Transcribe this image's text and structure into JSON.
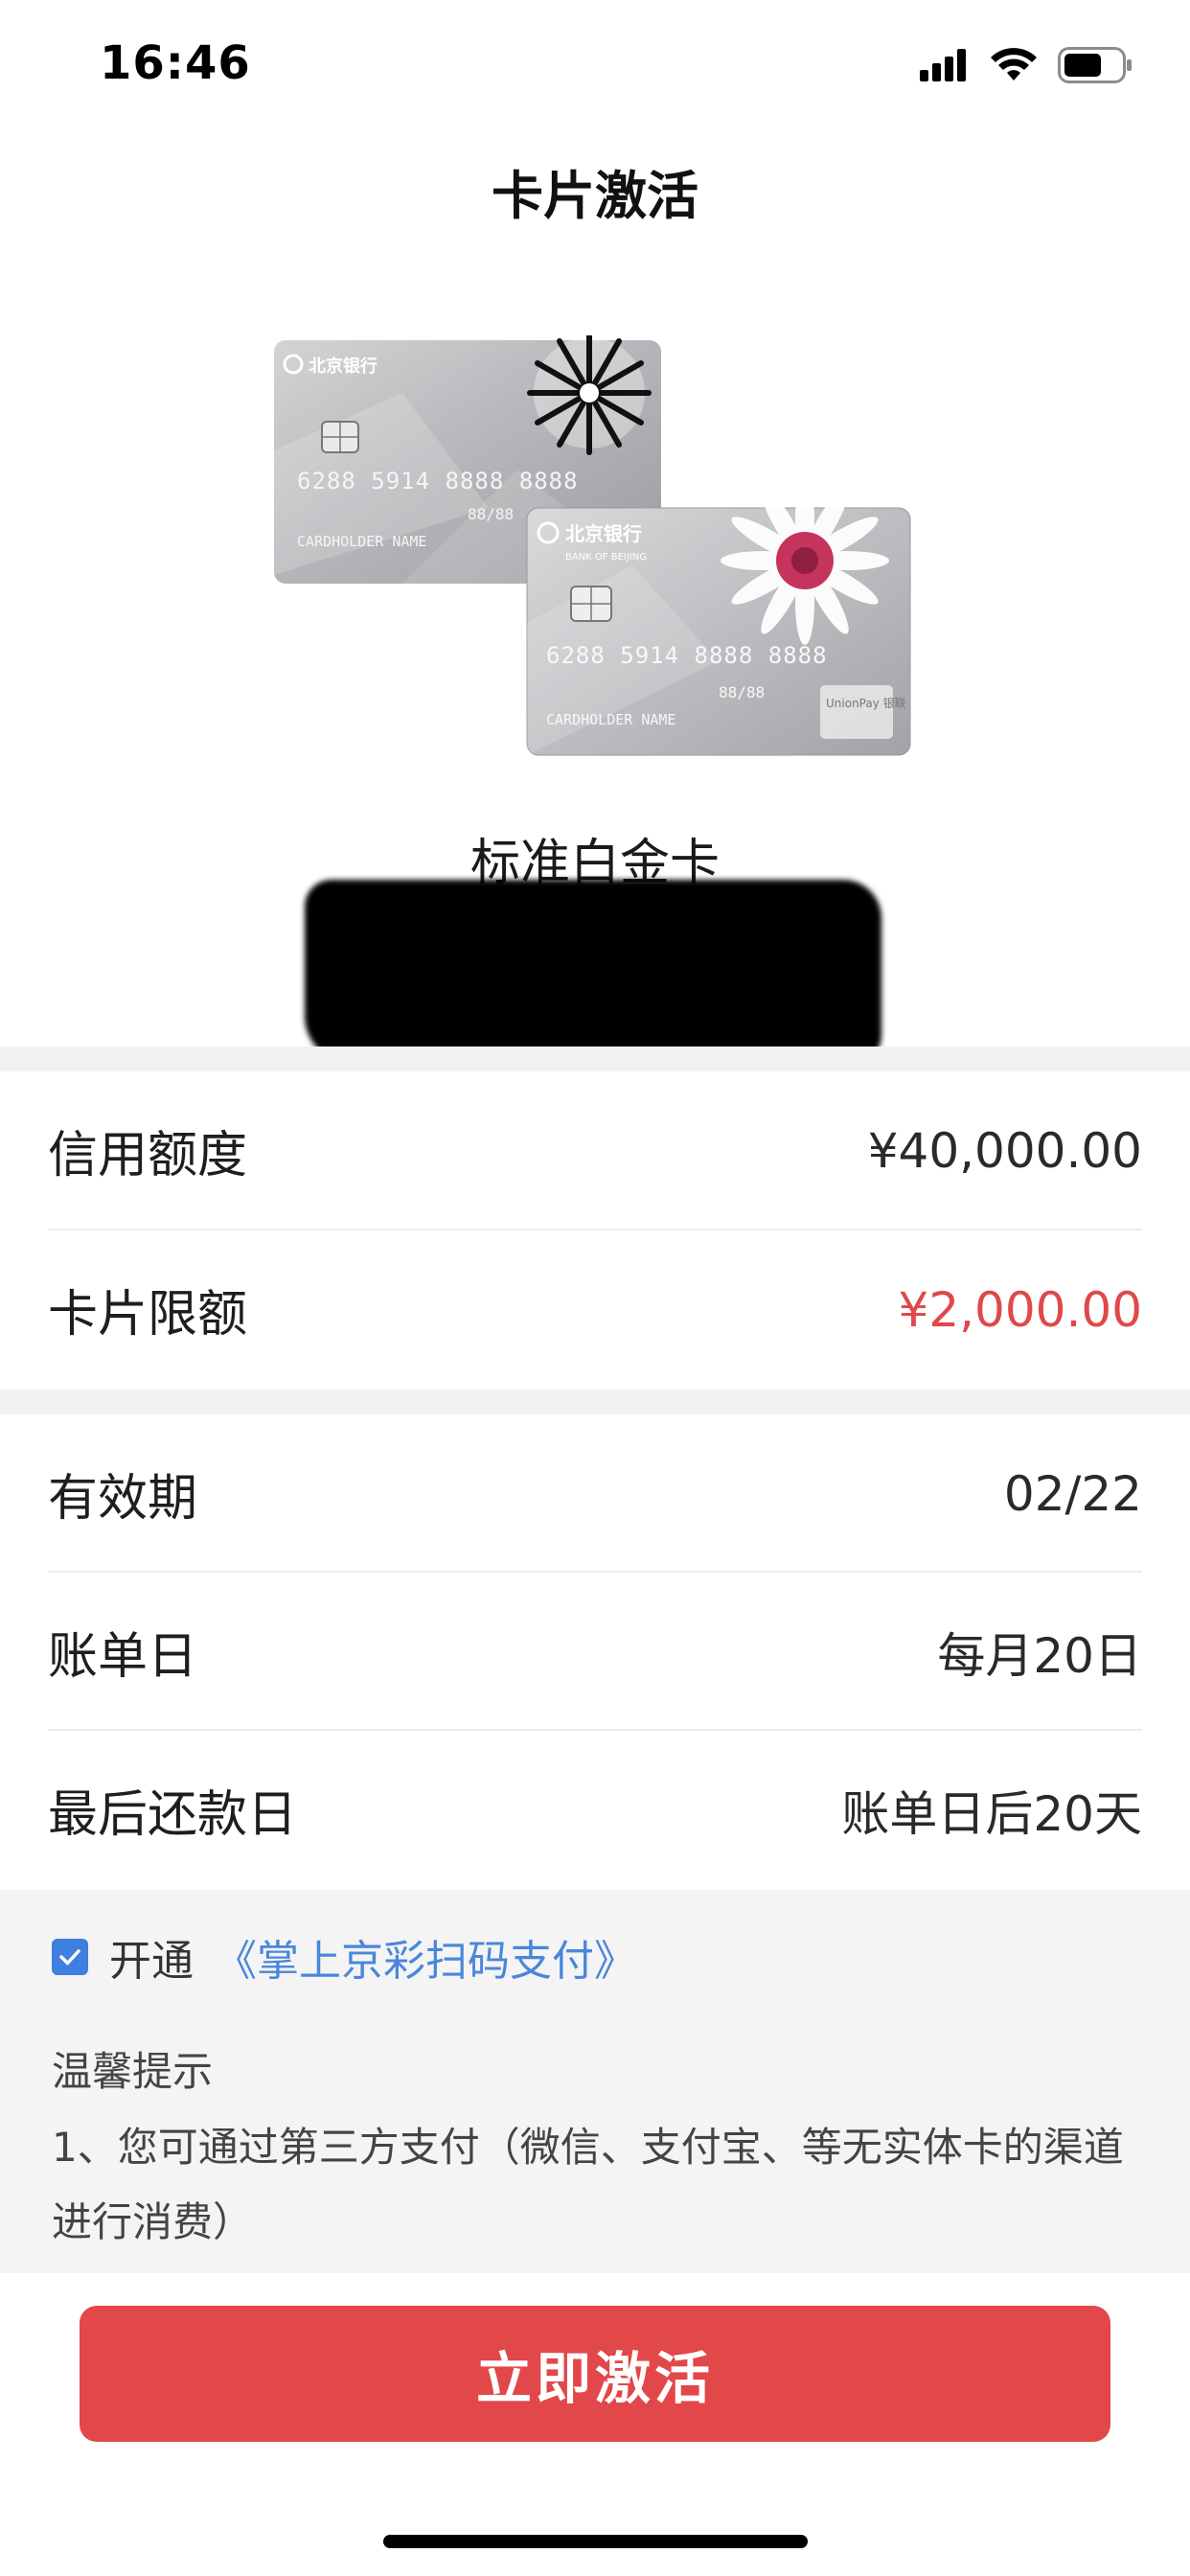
{
  "status_bar": {
    "time": "16:46",
    "icons": [
      "signal-icon",
      "wifi-icon",
      "battery-icon"
    ]
  },
  "header": {
    "title": "卡片激活"
  },
  "card": {
    "name": "标准白金卡",
    "art_bank_name": "北京银行",
    "art_bank_name_en": "BANK OF BEIJING",
    "art_number_front": "6288 5914 8888 8888",
    "art_number_back": "6288 5914 8888 8888",
    "art_expiry": "88/88",
    "art_holder": "CARDHOLDER NAME",
    "art_network": "UnionPay 银联"
  },
  "limits": [
    {
      "label": "信用额度",
      "value": "¥40,000.00",
      "highlight": false
    },
    {
      "label": "卡片限额",
      "value": "¥2,000.00",
      "highlight": true
    }
  ],
  "details": [
    {
      "label": "有效期",
      "value": "02/22"
    },
    {
      "label": "账单日",
      "value": "每月20日"
    },
    {
      "label": "最后还款日",
      "value": "账单日后20天"
    }
  ],
  "agreement": {
    "checked": true,
    "prefix": "开通",
    "link": "《掌上京彩扫码支付》"
  },
  "tips": {
    "title": "温馨提示",
    "body": "1、您可通过第三方支付（微信、支付宝、等无实体卡的渠道进行消费）"
  },
  "action": {
    "activate_label": "立即激活"
  },
  "colors": {
    "accent_red": "#e2474a",
    "link_blue": "#4a86dc",
    "checkbox_blue": "#3f7fe0"
  }
}
